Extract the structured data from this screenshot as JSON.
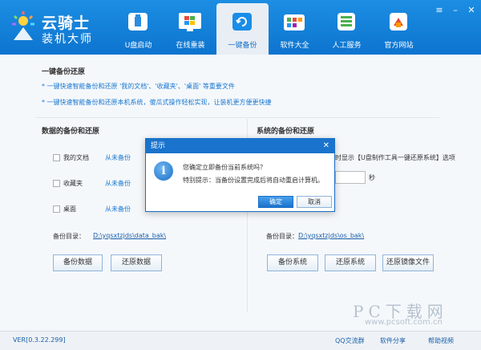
{
  "app": {
    "title": "云骑士",
    "subtitle": "装机大师"
  },
  "nav": {
    "items": [
      {
        "label": "U盘启动",
        "icon": "usb-icon"
      },
      {
        "label": "在线重装",
        "icon": "windows-icon"
      },
      {
        "label": "一键备份",
        "icon": "backup-icon",
        "active": true
      },
      {
        "label": "软件大全",
        "icon": "software-icon"
      },
      {
        "label": "人工服务",
        "icon": "service-icon"
      },
      {
        "label": "官方网站",
        "icon": "website-icon"
      }
    ]
  },
  "window": {
    "menu_glyph": "≡",
    "minimize_glyph": "–",
    "close_glyph": "✕"
  },
  "main": {
    "section_title": "一键备份还原",
    "tips": [
      "* 一键快速智能备份和还原 '我的文档'、'收藏夹'、'桌面' 等重要文件",
      "* 一键快速智能备份和还原本机系统，傻瓜式操作轻松实现，让装机更方便更快捷"
    ],
    "data_backup": {
      "title": "数据的备份和还原",
      "items": [
        {
          "label": "我的文档",
          "status": "从未备份"
        },
        {
          "label": "收藏夹",
          "status": "从未备份"
        },
        {
          "label": "桌面",
          "status": "从未备份"
        }
      ],
      "dir_label": "备份目录：",
      "dir_path": "D:\\yqsxtzjds\\data_bak\\",
      "backup_button": "备份数据",
      "restore_button": "还原数据"
    },
    "system_backup": {
      "title": "系统的备份和还原",
      "hint": "时显示【U盘制作工具一键还原系统】选项",
      "seconds_unit": "秒",
      "dir_label": "备份目录：",
      "dir_path": "D:\\yqsxtzjds\\os_bak\\",
      "backup_button": "备份系统",
      "restore_button": "还原系统",
      "restore_image_button": "还原镜像文件"
    }
  },
  "dialog": {
    "title": "提示",
    "close_glyph": "✕",
    "icon_glyph": "i",
    "message": "您确定立即备份当前系统吗？",
    "note": "特别提示：当备份设置完成后将自动重启计算机。",
    "ok_button": "确定",
    "cancel_button": "取消"
  },
  "footer": {
    "version": "VER[0.3.22.299]",
    "qq": "QQ交流群",
    "share": "软件分享",
    "help": "帮助视频"
  },
  "watermark": {
    "big": "PC下载网",
    "small": "www.pcsoft.com.cn"
  }
}
